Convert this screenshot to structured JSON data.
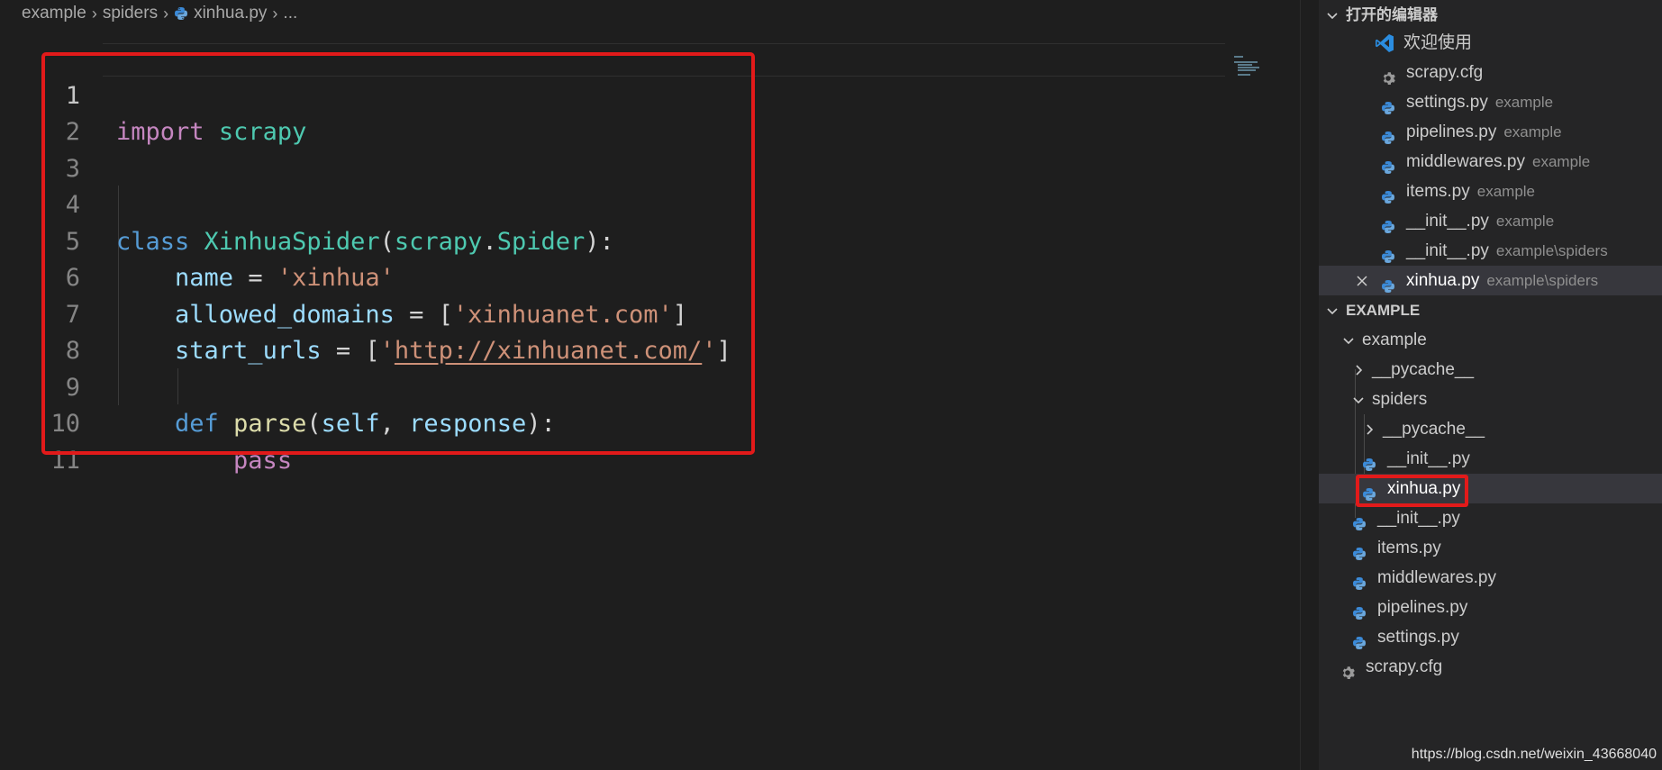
{
  "breadcrumb": {
    "parts": [
      "example",
      "spiders",
      "xinhua.py",
      "..."
    ]
  },
  "editor": {
    "line_numbers": [
      "1",
      "2",
      "3",
      "4",
      "5",
      "6",
      "7",
      "8",
      "9",
      "10",
      "11"
    ],
    "code": {
      "l1": {
        "kw": "import",
        "mod": "scrapy"
      },
      "l4": {
        "kw": "class",
        "cls": "XinhuaSpider",
        "p1": "(",
        "base_mod": "scrapy",
        "dot": ".",
        "base_cls": "Spider",
        "p2": "):"
      },
      "l5": {
        "var": "name",
        "eq": " = ",
        "str": "'xinhua'"
      },
      "l6": {
        "var": "allowed_domains",
        "eq": " = [",
        "str": "'xinhuanet.com'",
        "end": "]"
      },
      "l7": {
        "var": "start_urls",
        "eq": " = [",
        "q1": "'",
        "url": "http://xinhuanet.com/",
        "q2": "'",
        "end": "]"
      },
      "l9": {
        "kw": "def",
        "fn": "parse",
        "p1": "(",
        "self": "self",
        "comma": ", ",
        "param": "response",
        "p2": "):"
      },
      "l10": {
        "kw": "pass"
      }
    }
  },
  "sidebar": {
    "open_editors": {
      "header": "打开的编辑器",
      "items": [
        {
          "label": "欢迎使用",
          "desc": "",
          "icon": "vscode-icon"
        },
        {
          "label": "scrapy.cfg",
          "desc": "",
          "icon": "gear-icon"
        },
        {
          "label": "settings.py",
          "desc": "example",
          "icon": "python-icon"
        },
        {
          "label": "pipelines.py",
          "desc": "example",
          "icon": "python-icon"
        },
        {
          "label": "middlewares.py",
          "desc": "example",
          "icon": "python-icon"
        },
        {
          "label": "items.py",
          "desc": "example",
          "icon": "python-icon"
        },
        {
          "label": "__init__.py",
          "desc": "example",
          "icon": "python-icon"
        },
        {
          "label": "__init__.py",
          "desc": "example\\spiders",
          "icon": "python-icon"
        },
        {
          "label": "xinhua.py",
          "desc": "example\\spiders",
          "icon": "python-icon"
        }
      ]
    },
    "explorer": {
      "header": "EXAMPLE",
      "items": [
        {
          "label": "example"
        },
        {
          "label": "__pycache__"
        },
        {
          "label": "spiders"
        },
        {
          "label": "__pycache__"
        },
        {
          "label": "__init__.py"
        },
        {
          "label": "xinhua.py"
        },
        {
          "label": "__init__.py"
        },
        {
          "label": "items.py"
        },
        {
          "label": "middlewares.py"
        },
        {
          "label": "pipelines.py"
        },
        {
          "label": "settings.py"
        },
        {
          "label": "scrapy.cfg"
        }
      ]
    }
  },
  "watermark": "https://blog.csdn.net/weixin_43668040",
  "colors": {
    "background": "#1e1e1e",
    "sidebar": "#252526",
    "highlight_box": "#e21a1a",
    "python_icon": "#3b8ad8"
  }
}
